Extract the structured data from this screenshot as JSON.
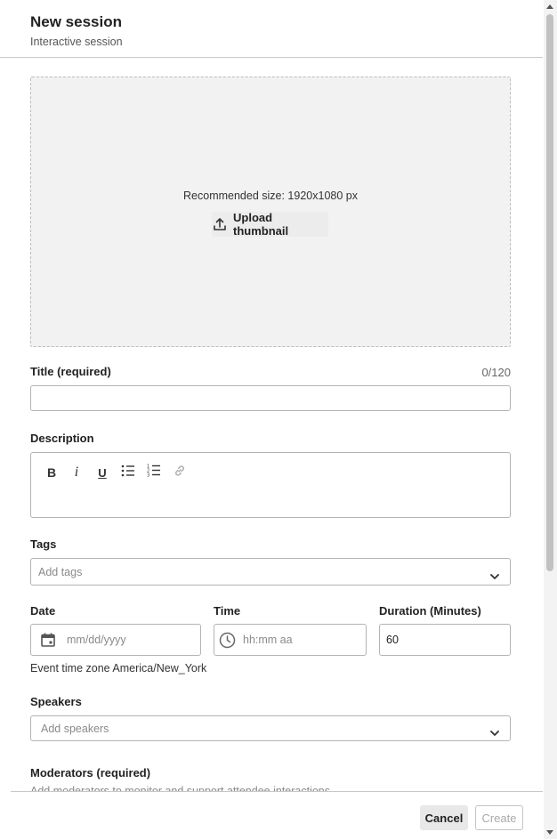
{
  "header": {
    "title": "New session",
    "subtitle": "Interactive session"
  },
  "thumbnail": {
    "hint": "Recommended size: 1920x1080 px",
    "upload_label": "Upload thumbnail",
    "icon": "upload-icon"
  },
  "title_field": {
    "label": "Title (required)",
    "counter": "0/120",
    "value": ""
  },
  "description": {
    "label": "Description",
    "toolbar": [
      {
        "name": "bold",
        "glyph": "B"
      },
      {
        "name": "italic",
        "glyph": "i"
      },
      {
        "name": "underline",
        "glyph": "U"
      },
      {
        "name": "bulleted-list",
        "glyph": ""
      },
      {
        "name": "numbered-list",
        "glyph": ""
      },
      {
        "name": "link",
        "glyph": ""
      }
    ]
  },
  "tags": {
    "label": "Tags",
    "placeholder": "Add tags"
  },
  "date": {
    "label": "Date",
    "placeholder": "mm/dd/yyyy",
    "icon": "calendar-icon"
  },
  "time": {
    "label": "Time",
    "placeholder": "hh:mm aa",
    "icon": "clock-icon"
  },
  "duration": {
    "label": "Duration (Minutes)",
    "value": "60"
  },
  "timezone_note": "Event time zone America/New_York",
  "speakers": {
    "label": "Speakers",
    "placeholder": "Add speakers"
  },
  "moderators": {
    "label": "Moderators (required)",
    "hint": "Add moderators to monitor and support attendee interactions"
  },
  "footer": {
    "cancel_label": "Cancel",
    "create_label": "Create"
  },
  "colors": {
    "border": "#b3b3b3",
    "dropzone_bg": "#f2f2f2",
    "text": "#222222",
    "muted": "#8a8a8a"
  }
}
